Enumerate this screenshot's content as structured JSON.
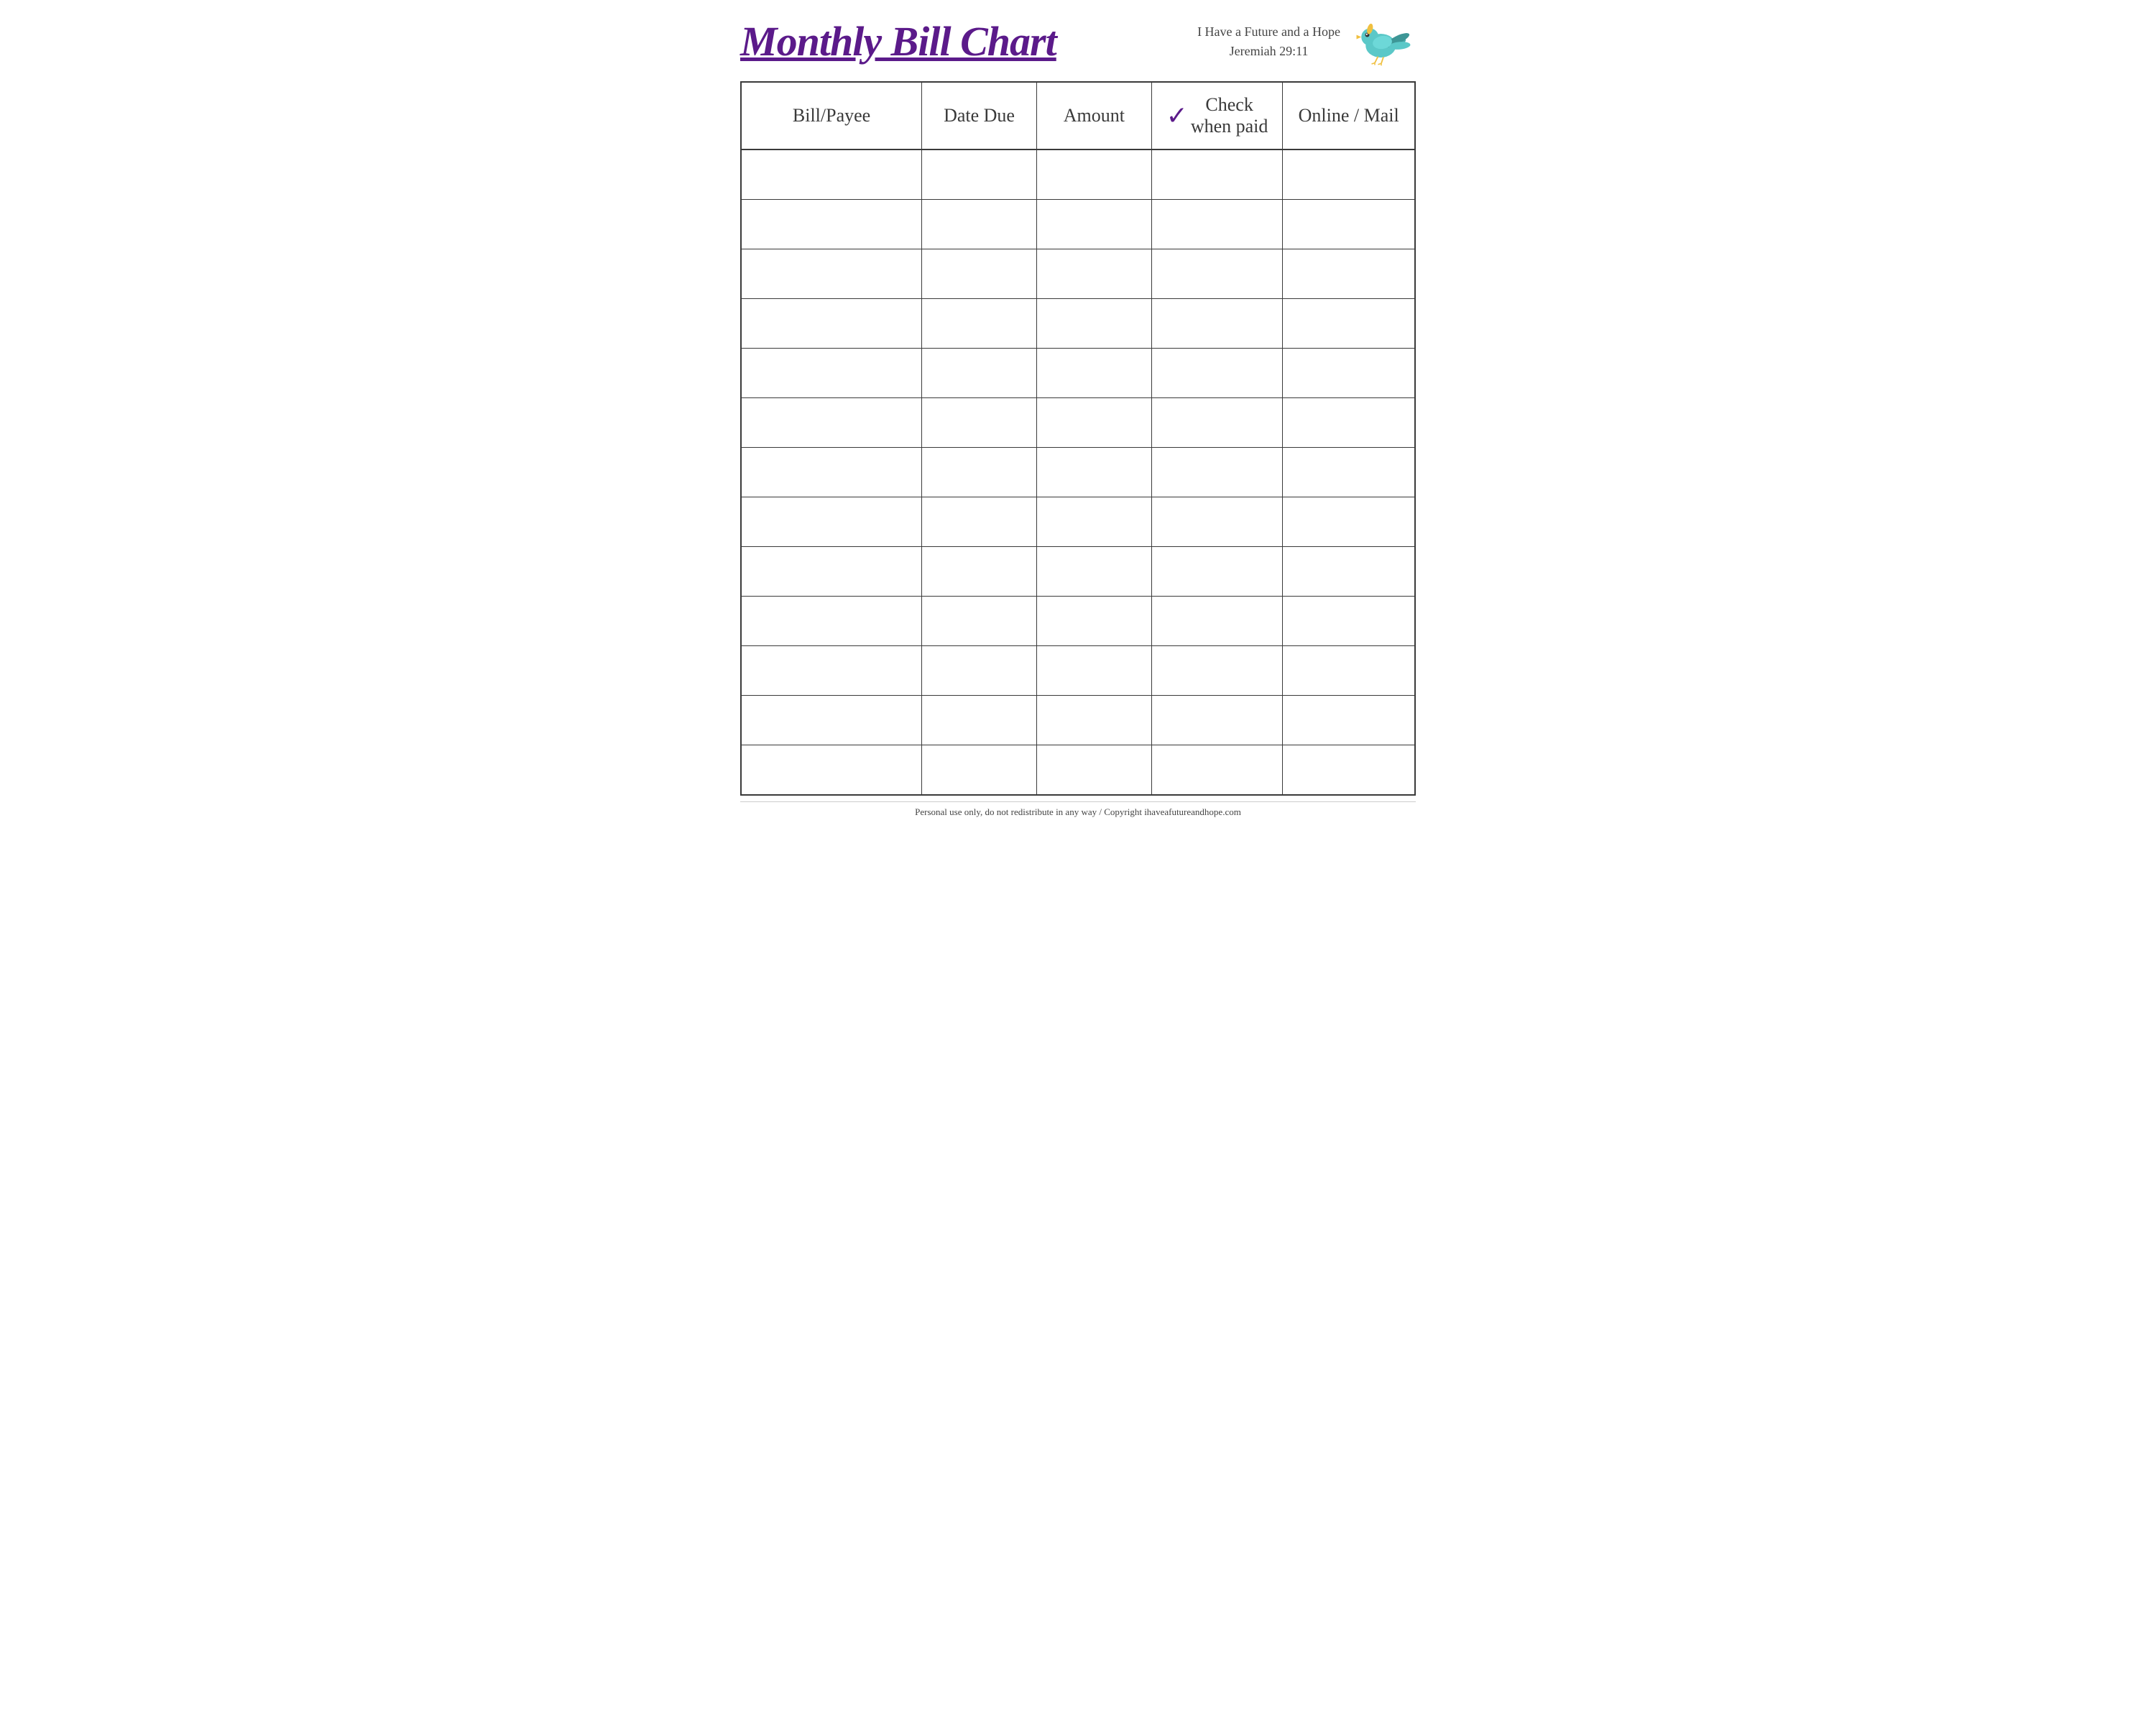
{
  "header": {
    "title": "Monthly Bill Chart",
    "scripture_line1": "I Have a Future and a Hope",
    "scripture_line2": "Jeremiah 29:11"
  },
  "table": {
    "columns": [
      {
        "id": "bill-payee",
        "label": "Bill/Payee"
      },
      {
        "id": "date-due",
        "label": "Date Due"
      },
      {
        "id": "amount",
        "label": "Amount"
      },
      {
        "id": "check-when-paid",
        "label_line1": "Check",
        "label_line2": "when paid",
        "has_checkmark": true
      },
      {
        "id": "online-mail",
        "label": "Online / Mail"
      }
    ],
    "row_count": 13
  },
  "footer": {
    "text": "Personal use only, do not redistribute in any way / Copyright ihaveafutureandhope.com"
  },
  "colors": {
    "title": "#5b1a8a",
    "checkmark": "#5b1a8a",
    "border": "#3a3a3a",
    "text": "#3a3a3a"
  }
}
